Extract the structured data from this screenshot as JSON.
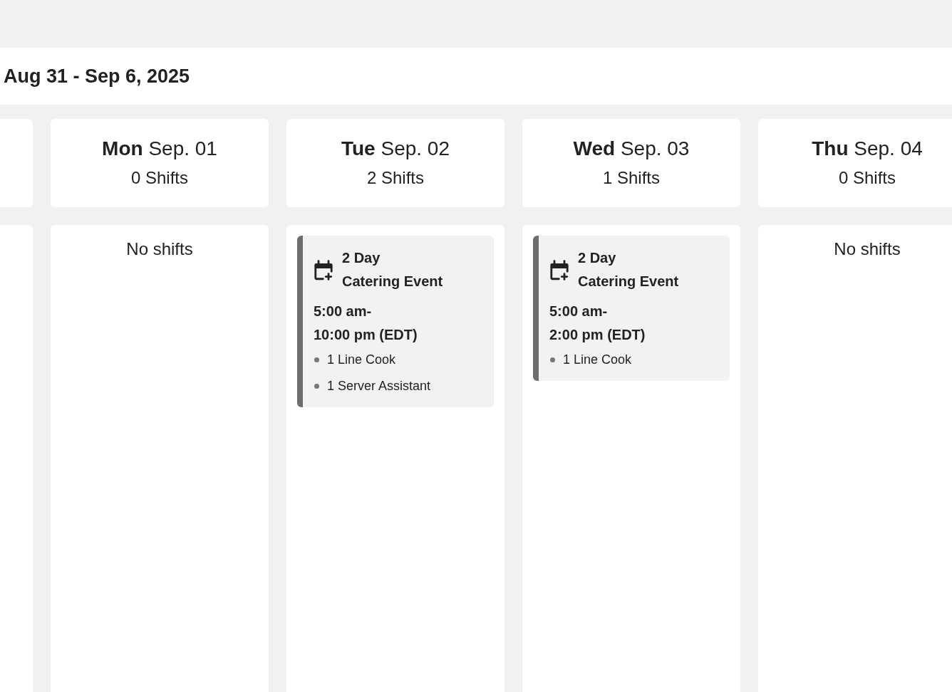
{
  "week_title": "Aug 31 - Sep 6, 2025",
  "days": [
    {
      "day": "Mon",
      "date": "Sep. 01",
      "shift_count": "0 Shifts",
      "no_shifts_text": "No shifts"
    },
    {
      "day": "Tue",
      "date": "Sep. 02",
      "shift_count": "2 Shifts",
      "shifts": [
        {
          "title": "2 Day\nCatering Event",
          "time": "5:00 am-\n10:00 pm (EDT)",
          "roles": [
            "1 Line Cook",
            "1 Server Assistant"
          ]
        }
      ]
    },
    {
      "day": "Wed",
      "date": "Sep. 03",
      "shift_count": "1 Shifts",
      "shifts": [
        {
          "title": "2 Day\nCatering Event",
          "time": "5:00 am-\n2:00 pm (EDT)",
          "roles": [
            "1 Line Cook"
          ]
        }
      ]
    },
    {
      "day": "Thu",
      "date": "Sep. 04",
      "shift_count": "0 Shifts",
      "no_shifts_text": "No shifts"
    }
  ]
}
